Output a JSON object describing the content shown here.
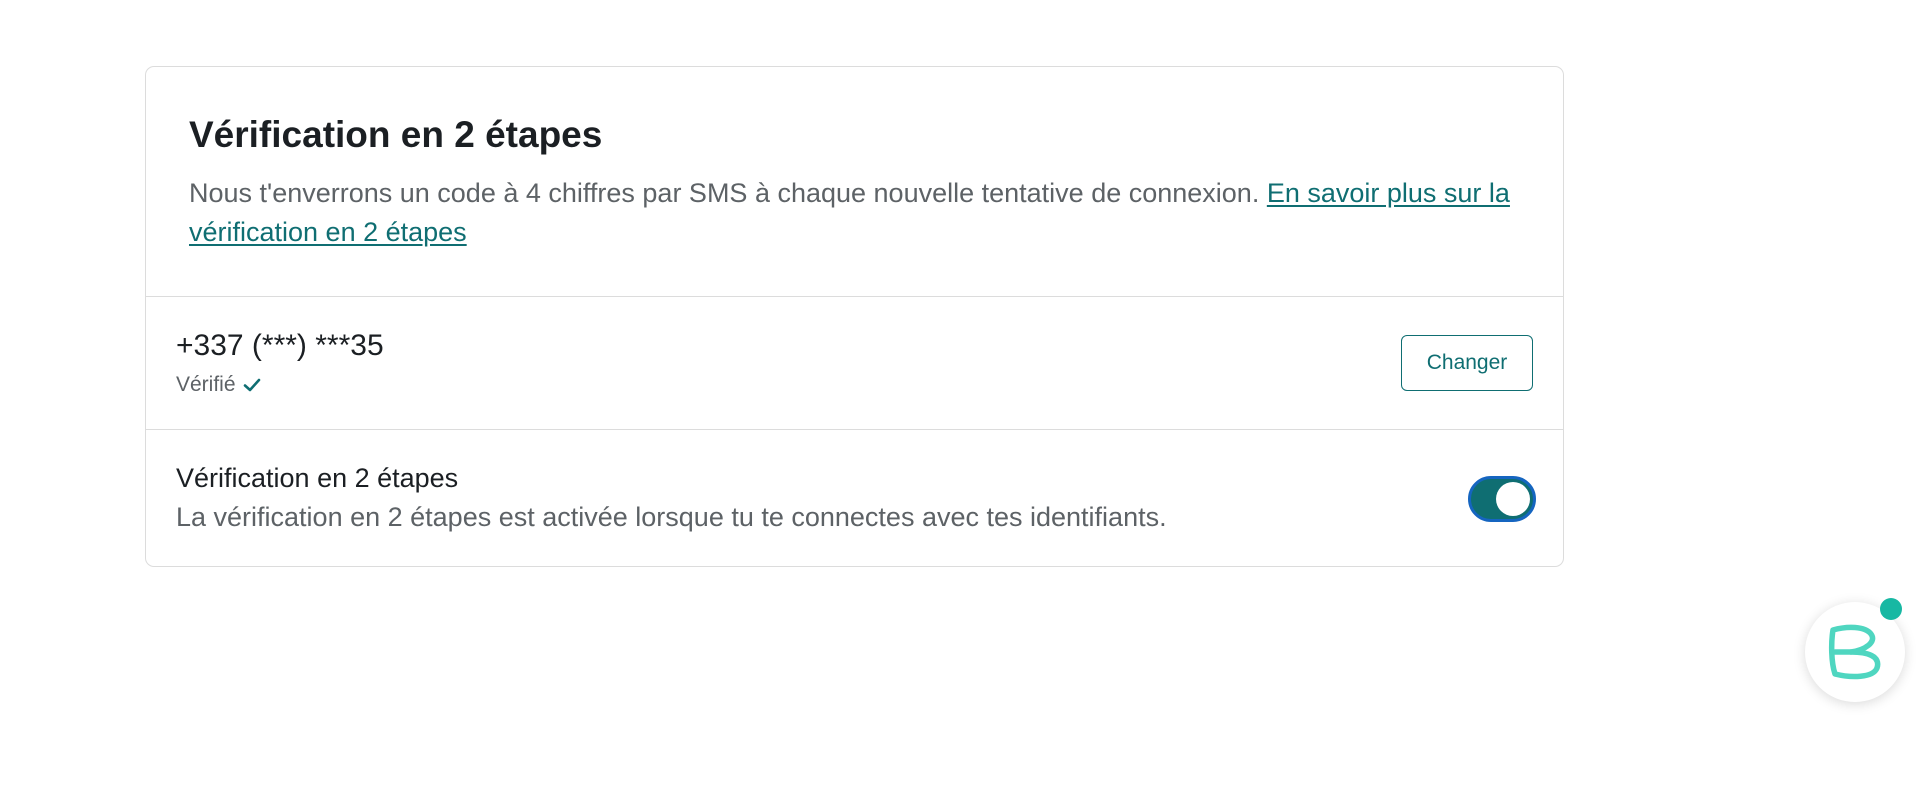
{
  "card": {
    "title": "Vérification en 2 étapes",
    "description": "Nous t'enverrons un code à 4 chiffres par SMS à chaque nouvelle tentative de connexion. ",
    "learn_more_link": "En savoir plus sur la vérification en 2 étapes"
  },
  "phone": {
    "number": "+337 (***) ***35",
    "status": "Vérifié",
    "status_icon": "check-icon",
    "change_label": "Changer"
  },
  "two_step": {
    "title": "Vérification en 2 étapes",
    "description": "La vérification en 2 étapes est activée lorsque tu te connectes avec tes identifiants.",
    "enabled": true
  },
  "chat_widget": {
    "icon": "chat-logo-icon",
    "has_notification": true
  },
  "colors": {
    "accent": "#0f6e72",
    "toggle_border": "#1565c0",
    "notification_dot": "#17b8a3",
    "logo": "#4fd6c0"
  }
}
